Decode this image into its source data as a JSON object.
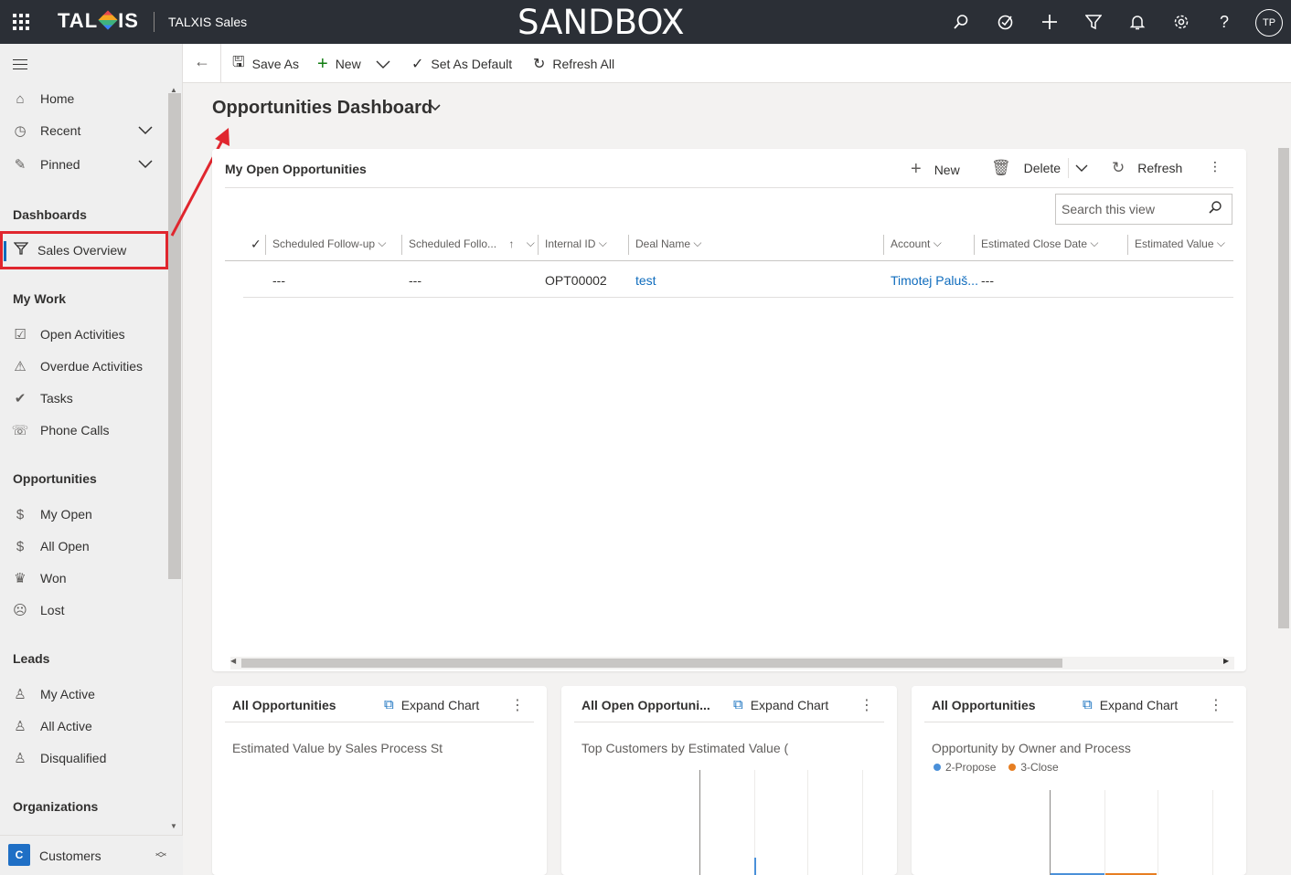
{
  "topbar": {
    "logo": "TALXIS",
    "app_name": "TALXIS Sales",
    "environment_label": "SANDBOX",
    "avatar_initials": "TP",
    "icons": [
      "search-icon",
      "assistant-icon",
      "add-icon",
      "filter-icon",
      "notification-icon",
      "settings-icon",
      "help-icon"
    ]
  },
  "sidebar": {
    "home": "Home",
    "recent": "Recent",
    "pinned": "Pinned",
    "sections": {
      "dashboards": "Dashboards",
      "my_work": "My Work",
      "opportunities": "Opportunities",
      "leads": "Leads",
      "organizations": "Organizations"
    },
    "dashboards": [
      "Sales Overview"
    ],
    "my_work": [
      "Open Activities",
      "Overdue Activities",
      "Tasks",
      "Phone Calls"
    ],
    "opportunities": [
      "My Open",
      "All Open",
      "Won",
      "Lost"
    ],
    "leads": [
      "My Active",
      "All Active",
      "Disqualified"
    ],
    "area": {
      "badge": "C",
      "label": "Customers"
    }
  },
  "commandbar": {
    "save_as": "Save As",
    "new": "New",
    "set_default": "Set As Default",
    "refresh_all": "Refresh All"
  },
  "dashboard": {
    "title": "Opportunities Dashboard"
  },
  "grid": {
    "title": "My Open Opportunities",
    "new": "New",
    "delete": "Delete",
    "refresh": "Refresh",
    "search_placeholder": "Search this view",
    "columns": [
      "Scheduled Follow-up",
      "Scheduled Follo...",
      "Internal ID",
      "Deal Name",
      "Account",
      "Estimated Close Date",
      "Estimated Value"
    ],
    "rows": [
      [
        "---",
        "---",
        "OPT00002",
        "test",
        "Timotej Paluš...",
        "---",
        ""
      ]
    ]
  },
  "charts": [
    {
      "title": "All Opportunities",
      "expand": "Expand Chart",
      "subtitle": "Estimated Value by Sales Process St"
    },
    {
      "title": "All Open Opportuni...",
      "expand": "Expand Chart",
      "subtitle": "Top Customers by Estimated Value ("
    },
    {
      "title": "All Opportunities",
      "expand": "Expand Chart",
      "subtitle": "Opportunity by Owner and Process",
      "legend": [
        "2-Propose",
        "3-Close"
      ]
    }
  ],
  "colors": {
    "topbar": "#2b2f36",
    "accent": "#0f6cbd",
    "highlight_annotation": "#e0262e",
    "legend_propose": "#4a90d9",
    "legend_close": "#e67e22"
  }
}
